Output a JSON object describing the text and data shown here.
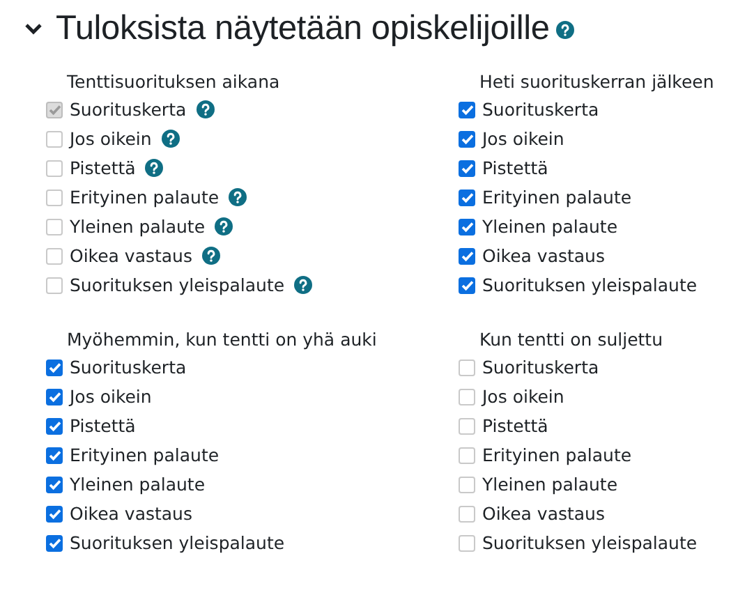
{
  "section": {
    "title": "Tuloksista näytetään opiskelijoille",
    "expanded": true,
    "help": true
  },
  "groups": [
    {
      "title": "Tenttisuorituksen aikana",
      "items": [
        {
          "label": "Suorituskerta",
          "checked": true,
          "disabled": true,
          "help": true
        },
        {
          "label": "Jos oikein",
          "checked": false,
          "disabled": false,
          "help": true
        },
        {
          "label": "Pistettä",
          "checked": false,
          "disabled": false,
          "help": true
        },
        {
          "label": "Erityinen palaute",
          "checked": false,
          "disabled": false,
          "help": true
        },
        {
          "label": "Yleinen palaute",
          "checked": false,
          "disabled": false,
          "help": true
        },
        {
          "label": "Oikea vastaus",
          "checked": false,
          "disabled": false,
          "help": true
        },
        {
          "label": "Suorituksen yleispalaute",
          "checked": false,
          "disabled": false,
          "help": true
        }
      ]
    },
    {
      "title": "Heti suorituskerran jälkeen",
      "items": [
        {
          "label": "Suorituskerta",
          "checked": true,
          "disabled": false
        },
        {
          "label": "Jos oikein",
          "checked": true,
          "disabled": false
        },
        {
          "label": "Pistettä",
          "checked": true,
          "disabled": false
        },
        {
          "label": "Erityinen palaute",
          "checked": true,
          "disabled": false
        },
        {
          "label": "Yleinen palaute",
          "checked": true,
          "disabled": false
        },
        {
          "label": "Oikea vastaus",
          "checked": true,
          "disabled": false
        },
        {
          "label": "Suorituksen yleispalaute",
          "checked": true,
          "disabled": false
        }
      ]
    },
    {
      "title": "Myöhemmin, kun tentti on yhä auki",
      "items": [
        {
          "label": "Suorituskerta",
          "checked": true,
          "disabled": false
        },
        {
          "label": "Jos oikein",
          "checked": true,
          "disabled": false
        },
        {
          "label": "Pistettä",
          "checked": true,
          "disabled": false
        },
        {
          "label": "Erityinen palaute",
          "checked": true,
          "disabled": false
        },
        {
          "label": "Yleinen palaute",
          "checked": true,
          "disabled": false
        },
        {
          "label": "Oikea vastaus",
          "checked": true,
          "disabled": false
        },
        {
          "label": "Suorituksen yleispalaute",
          "checked": true,
          "disabled": false
        }
      ]
    },
    {
      "title": "Kun tentti on suljettu",
      "items": [
        {
          "label": "Suorituskerta",
          "checked": false,
          "disabled": false
        },
        {
          "label": "Jos oikein",
          "checked": false,
          "disabled": false
        },
        {
          "label": "Pistettä",
          "checked": false,
          "disabled": false
        },
        {
          "label": "Erityinen palaute",
          "checked": false,
          "disabled": false
        },
        {
          "label": "Yleinen palaute",
          "checked": false,
          "disabled": false
        },
        {
          "label": "Oikea vastaus",
          "checked": false,
          "disabled": false
        },
        {
          "label": "Suorituksen yleispalaute",
          "checked": false,
          "disabled": false
        }
      ]
    }
  ]
}
